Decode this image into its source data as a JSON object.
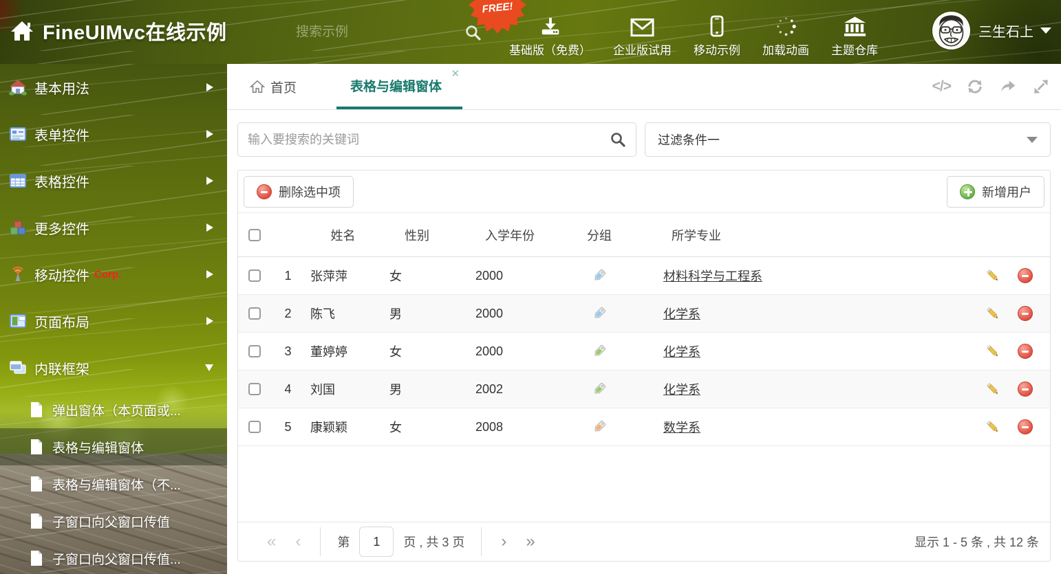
{
  "colors": {
    "accent": "#17796b",
    "free_badge": "#ea4a1f",
    "delete_red": "#d9534f",
    "add_green": "#5cb85c"
  },
  "header": {
    "title": "FineUIMvc在线示例",
    "search_placeholder": "搜索示例",
    "free_badge": "FREE!",
    "nav": [
      {
        "label": "基础版（免费）",
        "icon": "download-icon"
      },
      {
        "label": "企业版试用",
        "icon": "mail-icon"
      },
      {
        "label": "移动示例",
        "icon": "mobile-icon"
      },
      {
        "label": "加载动画",
        "icon": "spinner-icon"
      },
      {
        "label": "主题仓库",
        "icon": "bank-icon"
      }
    ],
    "user_name": "三生石上"
  },
  "sidebar": {
    "items": [
      {
        "label": "基本用法",
        "icon": "home-icon"
      },
      {
        "label": "表单控件",
        "icon": "form-icon"
      },
      {
        "label": "表格控件",
        "icon": "grid-icon"
      },
      {
        "label": "更多控件",
        "icon": "cubes-icon"
      },
      {
        "label": "移动控件",
        "badge": "Corp.",
        "icon": "antenna-icon"
      },
      {
        "label": "页面布局",
        "icon": "layout-icon"
      },
      {
        "label": "内联框架",
        "icon": "frames-icon",
        "expanded": true
      }
    ],
    "subitems": [
      {
        "label": "弹出窗体（本页面或..."
      },
      {
        "label": "表格与编辑窗体",
        "selected": true
      },
      {
        "label": "表格与编辑窗体（不..."
      },
      {
        "label": "子窗口向父窗口传值"
      },
      {
        "label": "子窗口向父窗口传值..."
      }
    ]
  },
  "tabs": {
    "home": "首页",
    "active": "表格与编辑窗体"
  },
  "search": {
    "placeholder": "输入要搜索的关键词"
  },
  "filter": {
    "value": "过滤条件一"
  },
  "toolbar": {
    "delete": "删除选中项",
    "add": "新增用户"
  },
  "table": {
    "columns": [
      "姓名",
      "性别",
      "入学年份",
      "分组",
      "所学专业"
    ],
    "rows": [
      {
        "num": "1",
        "name": "张萍萍",
        "gender": "女",
        "year": "2000",
        "tag_color": "#8ecdf5",
        "major": "材料科学与工程系"
      },
      {
        "num": "2",
        "name": "陈飞",
        "gender": "男",
        "year": "2000",
        "tag_color": "#8ecdf5",
        "major": "化学系"
      },
      {
        "num": "3",
        "name": "董婷婷",
        "gender": "女",
        "year": "2000",
        "tag_color": "#97cf63",
        "major": "化学系"
      },
      {
        "num": "4",
        "name": "刘国",
        "gender": "男",
        "year": "2002",
        "tag_color": "#97cf63",
        "major": "化学系"
      },
      {
        "num": "5",
        "name": "康颖颖",
        "gender": "女",
        "year": "2008",
        "tag_color": "#f7b269",
        "major": "数学系"
      }
    ]
  },
  "pagination": {
    "first": "«",
    "prev": "‹",
    "label_prefix": "第",
    "page": "1",
    "label_suffix": "页 , 共 3 页",
    "next": "›",
    "last": "»",
    "summary": "显示 1 - 5 条 , 共 12 条"
  }
}
